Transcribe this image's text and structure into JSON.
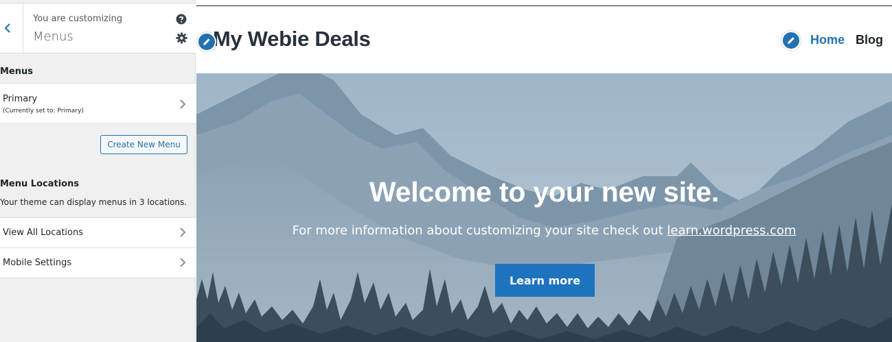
{
  "sidebar": {
    "header": {
      "customizing_label": "You are customizing",
      "title": "Menus"
    },
    "menus_section": {
      "title": "Menus",
      "items": [
        {
          "label": "Primary",
          "sublabel": "(Currently set to: Primary)"
        }
      ],
      "create_button": "Create New Menu"
    },
    "locations_section": {
      "title": "Menu Locations",
      "description": "Your theme can display menus in 3 locations.",
      "items": [
        {
          "label": "View All Locations"
        },
        {
          "label": "Mobile Settings"
        }
      ]
    }
  },
  "preview": {
    "site_title": "My Webie Deals",
    "nav": [
      {
        "label": "Home",
        "active": true
      },
      {
        "label": "Blog",
        "active": false
      }
    ],
    "hero": {
      "heading": "Welcome to your new site.",
      "text_before_link": "For more information about customizing your site check out ",
      "link_text": "learn.wordpress.com",
      "button_label": "Learn more"
    }
  },
  "icons": {
    "back": "chevron-left-icon",
    "help": "question-circle-icon",
    "settings": "gear-icon",
    "row_arrow": "chevron-right-icon",
    "edit": "pencil-icon"
  },
  "colors": {
    "accent": "#2271b1",
    "sidebar_bg": "#f0f0f1",
    "button_blue": "#1e73be",
    "hero_sky": "#9ab0c2"
  }
}
